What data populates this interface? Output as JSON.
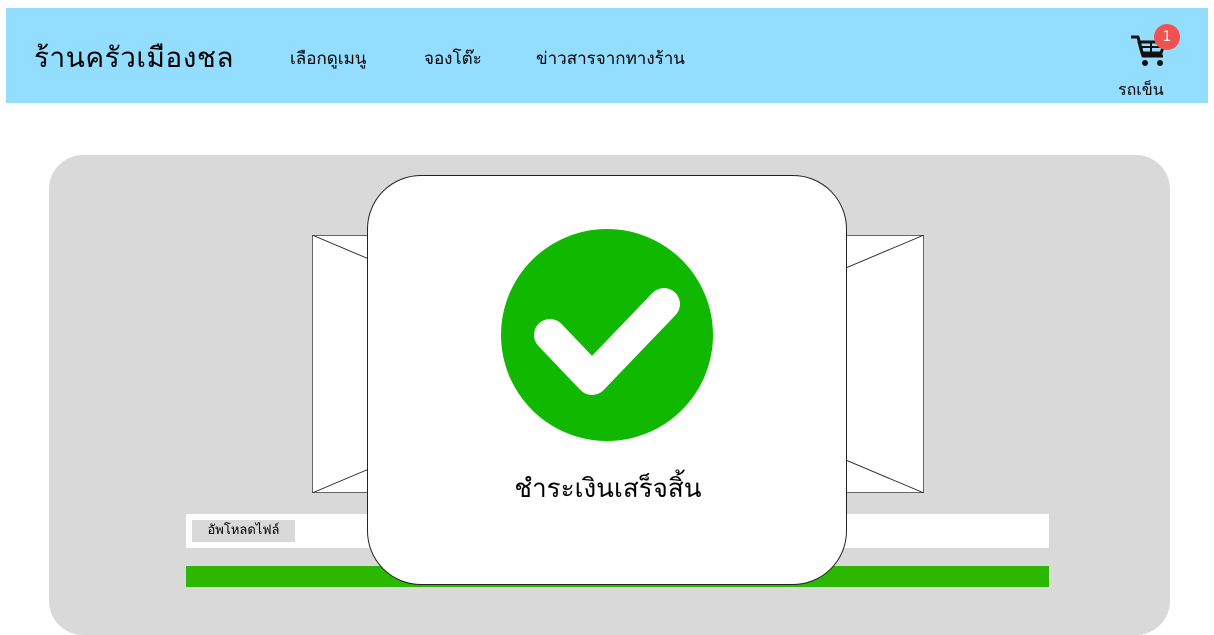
{
  "header": {
    "brand": "ร้านครัวเมืองชล",
    "nav": [
      "เลือกดูเมนู",
      "จองโต๊ะ",
      "ข่าวสารจากทางร้าน"
    ]
  },
  "cart": {
    "count": "1",
    "label": "รถเข็น",
    "icon": "cart-icon"
  },
  "upload": {
    "button_label": "อัพโหลดไฟล์",
    "progress_fraction": 1.0
  },
  "modal": {
    "message": "ชำระเงินเสร็จสิ้น",
    "icon": "check-circle-icon"
  },
  "colors": {
    "navbar": "#93ddff",
    "success": "#11b800",
    "progress": "#2cb800",
    "badge": "#f05252",
    "panel": "#d9d9d9"
  }
}
